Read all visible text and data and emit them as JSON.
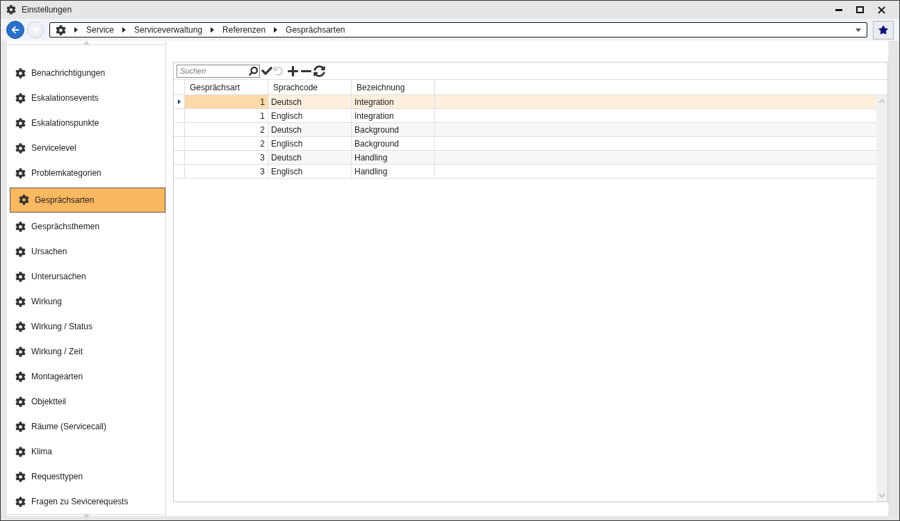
{
  "window": {
    "title": "Einstellungen"
  },
  "breadcrumb": [
    "Service",
    "Serviceverwaltung",
    "Referenzen",
    "Gesprächsarten"
  ],
  "sidebar": {
    "items": [
      {
        "label": "Benachrichtigungen",
        "selected": false
      },
      {
        "label": "Eskalationsevents",
        "selected": false
      },
      {
        "label": "Eskalationspunkte",
        "selected": false
      },
      {
        "label": "Servicelevel",
        "selected": false
      },
      {
        "label": "Problemkategorien",
        "selected": false
      },
      {
        "label": "Gesprächsarten",
        "selected": true
      },
      {
        "label": "Gesprächsthemen",
        "selected": false
      },
      {
        "label": "Ursachen",
        "selected": false
      },
      {
        "label": "Unterursachen",
        "selected": false
      },
      {
        "label": "Wirkung",
        "selected": false
      },
      {
        "label": "Wirkung / Status",
        "selected": false
      },
      {
        "label": "Wirkung / Zeit",
        "selected": false
      },
      {
        "label": "Montagearten",
        "selected": false
      },
      {
        "label": "Objektteil",
        "selected": false
      },
      {
        "label": "Räume (Servicecall)",
        "selected": false
      },
      {
        "label": "Klima",
        "selected": false
      },
      {
        "label": "Requesttypen",
        "selected": false
      },
      {
        "label": "Fragen zu Sevicerequests",
        "selected": false
      }
    ]
  },
  "search": {
    "placeholder": "Suchen"
  },
  "table": {
    "columns": [
      "Gesprächsart",
      "Sprachcode",
      "Bezeichnung"
    ],
    "rows": [
      {
        "cells": [
          "1",
          "Deutsch",
          "Integration"
        ],
        "selected": true
      },
      {
        "cells": [
          "1",
          "Englisch",
          "Integration"
        ],
        "selected": false
      },
      {
        "cells": [
          "2",
          "Deutsch",
          "Background"
        ],
        "selected": false
      },
      {
        "cells": [
          "2",
          "Englisch",
          "Background"
        ],
        "selected": false
      },
      {
        "cells": [
          "3",
          "Deutsch",
          "Handling"
        ],
        "selected": false
      },
      {
        "cells": [
          "3",
          "Englisch",
          "Handling"
        ],
        "selected": false
      }
    ]
  }
}
